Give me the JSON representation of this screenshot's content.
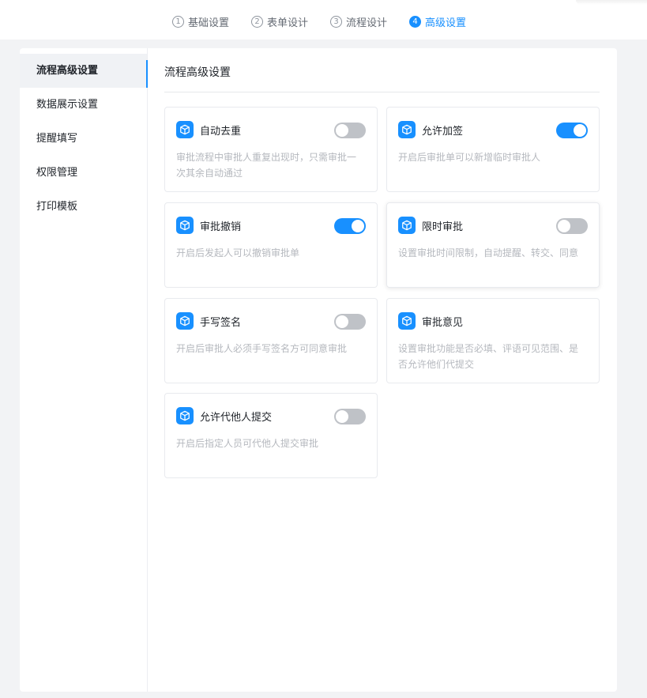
{
  "steps": [
    {
      "num": "1",
      "label": "基础设置",
      "active": false
    },
    {
      "num": "2",
      "label": "表单设计",
      "active": false
    },
    {
      "num": "3",
      "label": "流程设计",
      "active": false
    },
    {
      "num": "4",
      "label": "高级设置",
      "active": true
    }
  ],
  "sidebar": {
    "items": [
      {
        "label": "流程高级设置",
        "active": true
      },
      {
        "label": "数据展示设置",
        "active": false
      },
      {
        "label": "提醒填写",
        "active": false
      },
      {
        "label": "权限管理",
        "active": false
      },
      {
        "label": "打印模板",
        "active": false
      }
    ]
  },
  "main": {
    "title": "流程高级设置",
    "cards": [
      {
        "title": "自动去重",
        "desc": "审批流程中审批人重复出现时，只需审批一次其余自动通过",
        "enabled": false,
        "icon": "cube-icon"
      },
      {
        "title": "允许加签",
        "desc": "开启后审批单可以新增临时审批人",
        "enabled": true,
        "icon": "cube-icon"
      },
      {
        "title": "审批撤销",
        "desc": "开启后发起人可以撤销审批单",
        "enabled": true,
        "icon": "cube-icon"
      },
      {
        "title": "限时审批",
        "desc": "设置审批时间限制，自动提醒、转交、同意",
        "enabled": false,
        "icon": "cube-icon"
      },
      {
        "title": "手写签名",
        "desc": "开启后审批人必须手写签名方可同意审批",
        "enabled": false,
        "icon": "cube-icon"
      },
      {
        "title": "审批意见",
        "desc": "设置审批功能是否必填、评语可见范围、是否允许他们代提交",
        "enabled": null,
        "icon": "cube-icon"
      },
      {
        "title": "允许代他人提交",
        "desc": "开启后指定人员可代他人提交审批",
        "enabled": false,
        "icon": "cube-icon"
      }
    ]
  },
  "colors": {
    "accent": "#1890ff",
    "toggle_off": "#bfc2c7",
    "page_bg": "#f2f3f5"
  }
}
